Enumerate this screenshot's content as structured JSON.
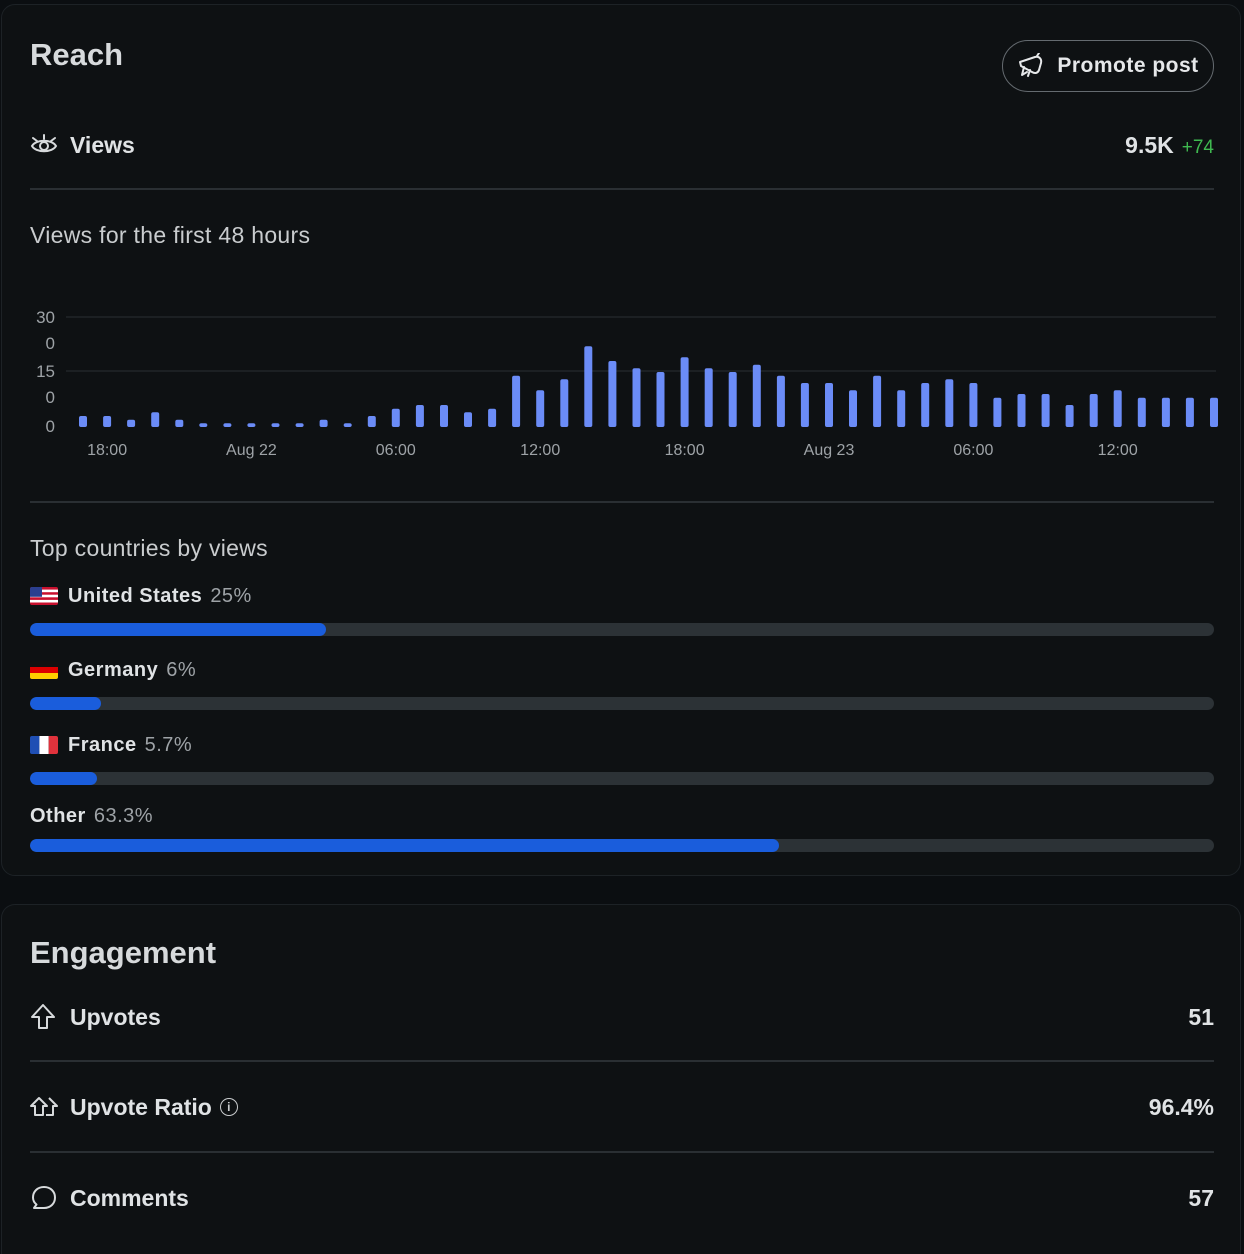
{
  "reach": {
    "title": "Reach",
    "promote_label": "Promote post",
    "views_label": "Views",
    "views_value": "9.5K",
    "views_delta": "+74",
    "chart_heading": "Views for the first 48 hours",
    "countries_heading": "Top countries by views",
    "countries": [
      {
        "flag": "us",
        "name": "United States",
        "pct_label": "25%",
        "share": 0.25
      },
      {
        "flag": "de",
        "name": "Germany",
        "pct_label": "6%",
        "share": 0.06
      },
      {
        "flag": "fr",
        "name": "France",
        "pct_label": "5.7%",
        "share": 0.057
      },
      {
        "flag": "",
        "name": "Other",
        "pct_label": "63.3%",
        "share": 0.633
      }
    ]
  },
  "chart_data": {
    "type": "bar",
    "title": "Views for the first 48 hours",
    "color": "#6b8cf7",
    "y_tick_labels": [
      "30",
      "0",
      "15",
      "0",
      "0"
    ],
    "x_tick_labels": [
      "18:00",
      "Aug 22",
      "06:00",
      "12:00",
      "18:00",
      "Aug 23",
      "06:00",
      "12:00"
    ],
    "x_tick_bar_index": [
      1,
      7,
      13,
      19,
      25,
      31,
      37,
      43
    ],
    "ylim": [
      0,
      30
    ],
    "values": [
      3,
      3,
      2,
      4,
      2,
      1,
      1,
      1,
      1,
      1,
      2,
      1,
      3,
      5,
      6,
      6,
      4,
      5,
      14,
      10,
      13,
      22,
      18,
      16,
      15,
      19,
      16,
      15,
      17,
      14,
      12,
      12,
      10,
      14,
      10,
      12,
      13,
      12,
      8,
      9,
      9,
      6,
      9,
      10,
      8,
      8,
      8,
      8
    ],
    "grid": true
  },
  "engagement": {
    "title": "Engagement",
    "rows": [
      {
        "label": "Upvotes",
        "value": "51"
      },
      {
        "label": "Upvote Ratio",
        "value": "96.4%"
      },
      {
        "label": "Comments",
        "value": "57"
      }
    ]
  }
}
